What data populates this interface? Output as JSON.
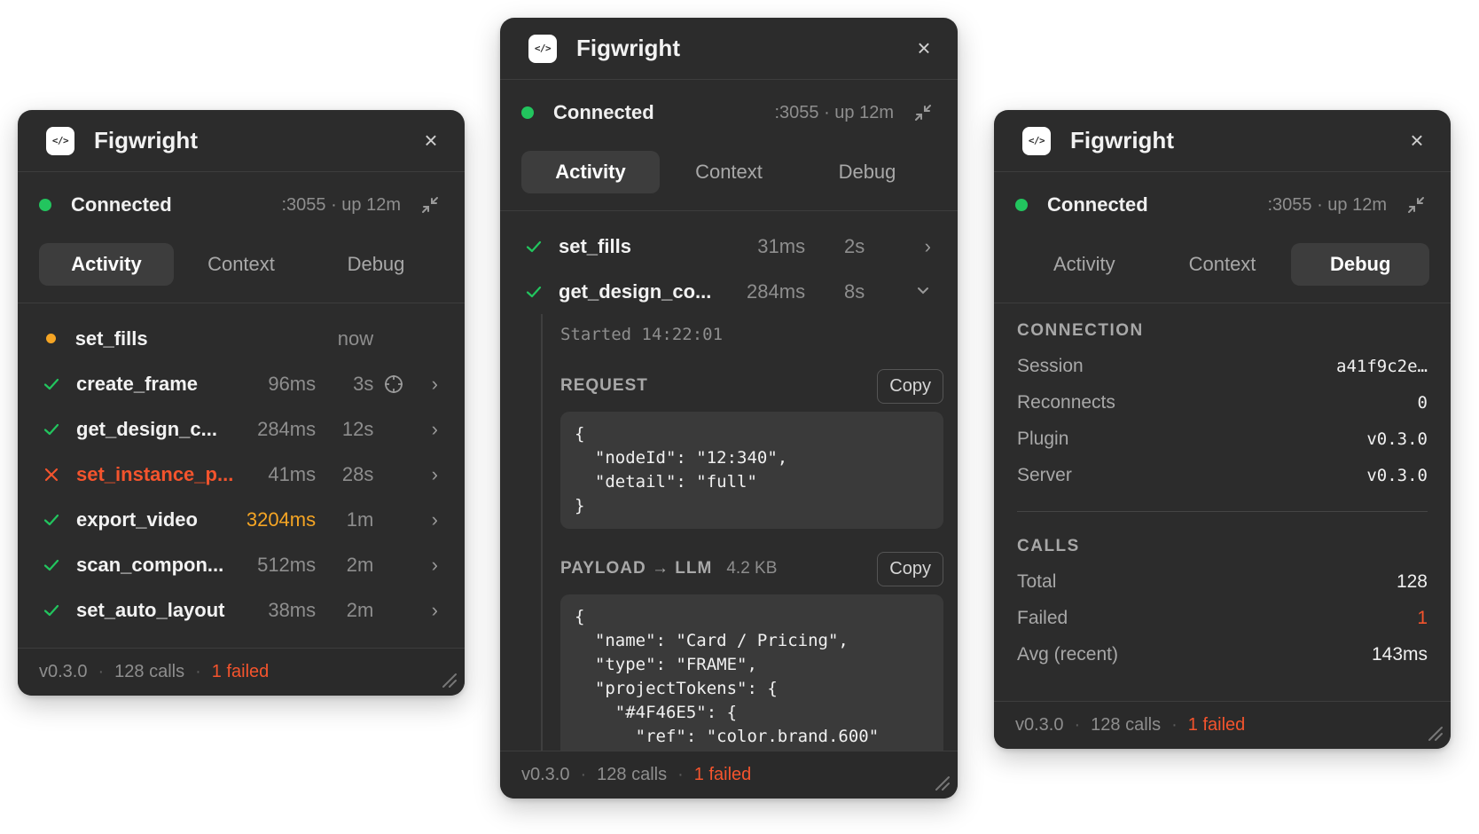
{
  "app": {
    "title": "Figwright",
    "logo": "</>"
  },
  "status": {
    "label": "Connected",
    "meta": ":3055 · up 12m"
  },
  "tabs": [
    "Activity",
    "Context",
    "Debug"
  ],
  "footer": {
    "version": "v0.3.0",
    "calls": "128 calls",
    "failed": "1 failed"
  },
  "colors": {
    "panel_bg": "#2c2c2c",
    "success": "#22c55e",
    "error": "#f4542d",
    "warning": "#f5a524"
  },
  "panel1": {
    "activity": [
      {
        "state": "pending",
        "name": "set_fills",
        "duration": "",
        "ago": "now"
      },
      {
        "state": "success",
        "name": "create_frame",
        "duration": "96ms",
        "ago": "3s",
        "extra_icon": "crosshair-icon"
      },
      {
        "state": "success",
        "name": "get_design_c...",
        "duration": "284ms",
        "ago": "12s"
      },
      {
        "state": "error",
        "name": "set_instance_p...",
        "duration": "41ms",
        "ago": "28s"
      },
      {
        "state": "success",
        "name": "export_video",
        "duration": "3204ms",
        "ago": "1m",
        "slow": true
      },
      {
        "state": "success",
        "name": "scan_compon...",
        "duration": "512ms",
        "ago": "2m"
      },
      {
        "state": "success",
        "name": "set_auto_layout",
        "duration": "38ms",
        "ago": "2m"
      }
    ]
  },
  "panel2": {
    "activity": [
      {
        "state": "success",
        "name": "set_fills",
        "duration": "31ms",
        "ago": "2s",
        "chevron": "chevron-right-icon"
      },
      {
        "state": "success",
        "name": "get_design_co...",
        "duration": "284ms",
        "ago": "8s",
        "chevron": "chevron-down-icon"
      }
    ],
    "detail": {
      "started": "Started 14:22:01",
      "request_title": "REQUEST",
      "copy_label": "Copy",
      "request_code": "{\n  \"nodeId\": \"12:340\",\n  \"detail\": \"full\"\n}",
      "payload_title": "PAYLOAD → LLM",
      "payload_size": "4.2 KB",
      "payload_code": "{\n  \"name\": \"Card / Pricing\",\n  \"type\": \"FRAME\",\n  \"projectTokens\": {\n    \"#4F46E5\": {\n      \"ref\": \"color.brand.600\""
    }
  },
  "panel3": {
    "connection": {
      "heading": "CONNECTION",
      "rows": [
        {
          "key": "Session",
          "value": "a41f9c2e…"
        },
        {
          "key": "Reconnects",
          "value": "0"
        },
        {
          "key": "Plugin",
          "value": "v0.3.0"
        },
        {
          "key": "Server",
          "value": "v0.3.0"
        }
      ]
    },
    "calls": {
      "heading": "CALLS",
      "rows": [
        {
          "key": "Total",
          "value": "128"
        },
        {
          "key": "Failed",
          "value": "1"
        },
        {
          "key": "Avg (recent)",
          "value": "143ms"
        }
      ]
    }
  }
}
